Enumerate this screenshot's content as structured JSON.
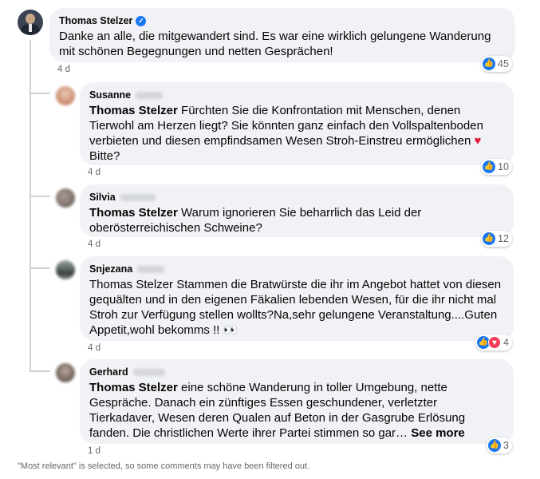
{
  "main_comment": {
    "author": "Thomas Stelzer",
    "verified": true,
    "text": "Danke an alle, die mitgewandert sind. Es war eine wirklich gelungene Wanderung mit schönen Begegnungen und netten Gesprächen!",
    "time": "4 d",
    "reaction_count": "45"
  },
  "replies": [
    {
      "author": "Susanne",
      "mention": "Thomas Stelzer",
      "text": " Fürchten Sie die Konfrontation mit Menschen, denen Tierwohl am Herzen liegt? Sie könnten ganz einfach den Vollspaltenboden verbieten und diesen empfindsamen Wesen Stroh-Einstreu ermöglichen ",
      "emoji": "♥",
      "text_end": " Bitte?",
      "time": "4 d",
      "reaction_count": "10"
    },
    {
      "author": "Silvia",
      "mention": "Thomas Stelzer",
      "text": " Warum ignorieren Sie beharrlich das Leid der oberösterreichischen Schweine?",
      "time": "4 d",
      "reaction_count": "12"
    },
    {
      "author": "Snjezana",
      "text": "Thomas Stelzer Stammen die Bratwürste die ihr im Angebot hattet von diesen gequälten und in den eigenen Fäkalien lebenden Wesen, für die ihr nicht mal Stroh zur Verfügung stellen wollts?Na,sehr gelungene Veranstaltung....Guten Appetit,wohl bekomms !! 👀",
      "time": "4 d",
      "reaction_count": "4"
    },
    {
      "author": "Gerhard",
      "mention": "Thomas Stelzer",
      "text": " eine schöne Wanderung in toller Umgebung, nette Gespräche. Danach ein zünftiges Essen geschundener, verletzter Tierkadaver, Wesen deren Qualen auf Beton in der Gasgrube Erlösung fanden. Die christlichen Werte ihrer Partei stimmen so gar… ",
      "see_more": "See more",
      "time": "1 d",
      "reaction_count": "3"
    }
  ],
  "footer_note": "\"Most relevant\" is selected, so some comments may have been filtered out.",
  "colors": {
    "bubble": "#f0f2f5",
    "like": "#1877f2",
    "love": "#f33e58",
    "muted": "#65676b"
  }
}
